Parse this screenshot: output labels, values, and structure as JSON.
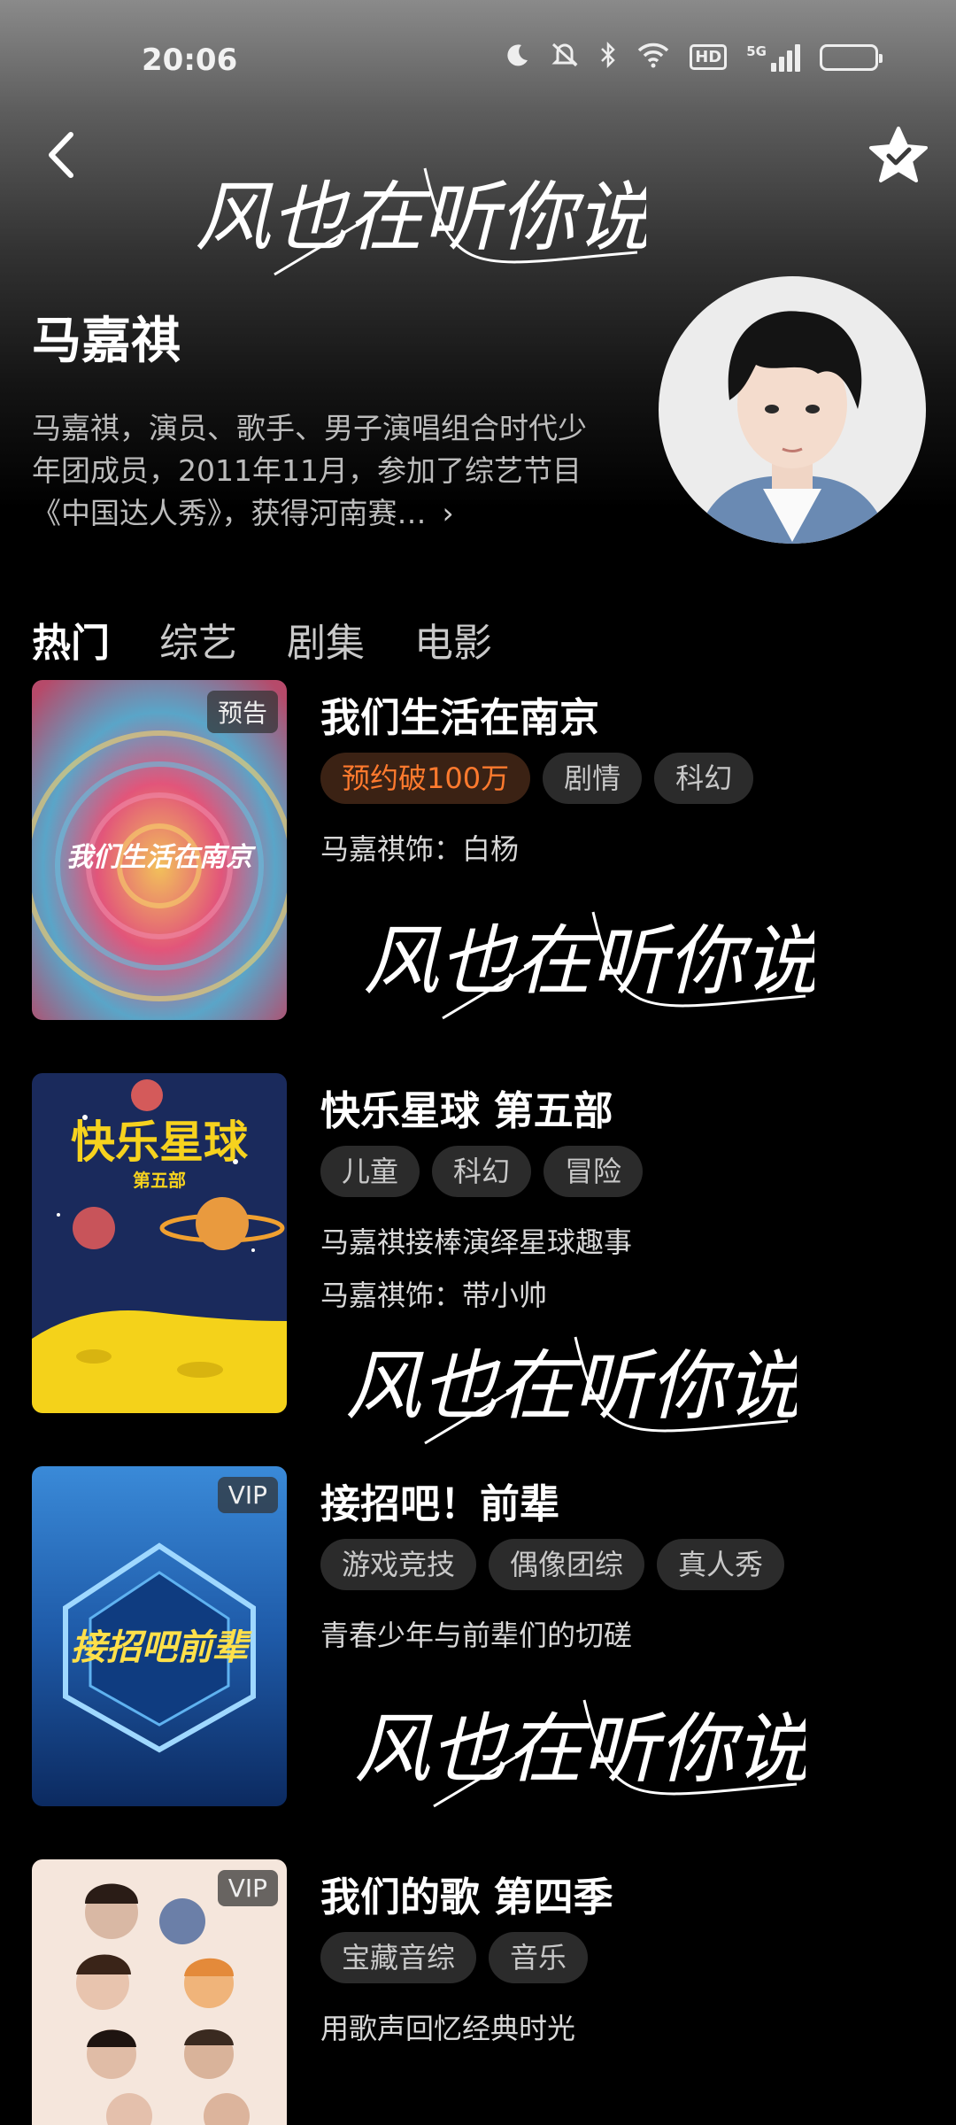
{
  "status_bar": {
    "time": "20:06",
    "icons": [
      "moon-icon",
      "bell-off-icon",
      "bluetooth-icon",
      "wifi-icon",
      "hd-icon",
      "signal-icon",
      "battery-icon"
    ],
    "hd_label": "HD",
    "network_label": "5G",
    "battery_color": "#f2b01e"
  },
  "watermark": "风也在听你说",
  "artist": {
    "name": "马嘉祺",
    "bio": "马嘉祺，演员、歌手、男子演唱组合时代少年团成员，2011年11月，参加了综艺节目《中国达人秀》，获得河南赛…",
    "more": "›"
  },
  "tabs": [
    "热门",
    "综艺",
    "剧集",
    "电影"
  ],
  "shows": [
    {
      "title": "我们生活在南京",
      "badge": "预告",
      "poster_text": "我们生活在南京",
      "tags": [
        {
          "label": "预约破100万",
          "hot": true
        },
        {
          "label": "剧情"
        },
        {
          "label": "科幻"
        }
      ],
      "desc": [
        "马嘉祺饰：白杨"
      ]
    },
    {
      "title": "快乐星球 第五部",
      "badge": "",
      "poster_text": "快乐星球",
      "poster_sub": "第五部",
      "tags": [
        {
          "label": "儿童"
        },
        {
          "label": "科幻"
        },
        {
          "label": "冒险"
        }
      ],
      "desc": [
        "马嘉祺接棒演绎星球趣事",
        "马嘉祺饰：带小帅"
      ]
    },
    {
      "title": "接招吧！前辈",
      "badge": "VIP",
      "poster_text": "接招吧前辈",
      "tags": [
        {
          "label": "游戏竞技"
        },
        {
          "label": "偶像团综"
        },
        {
          "label": "真人秀"
        }
      ],
      "desc": [
        "青春少年与前辈们的切磋"
      ]
    },
    {
      "title": "我们的歌 第四季",
      "badge": "VIP",
      "tags": [
        {
          "label": "宝藏音综"
        },
        {
          "label": "音乐"
        }
      ],
      "desc": [
        "用歌声回忆经典时光"
      ]
    }
  ],
  "colors": {
    "accent_orange": "#ff7a2e",
    "tag_bg": "#2b2b2b",
    "background": "#000000"
  }
}
